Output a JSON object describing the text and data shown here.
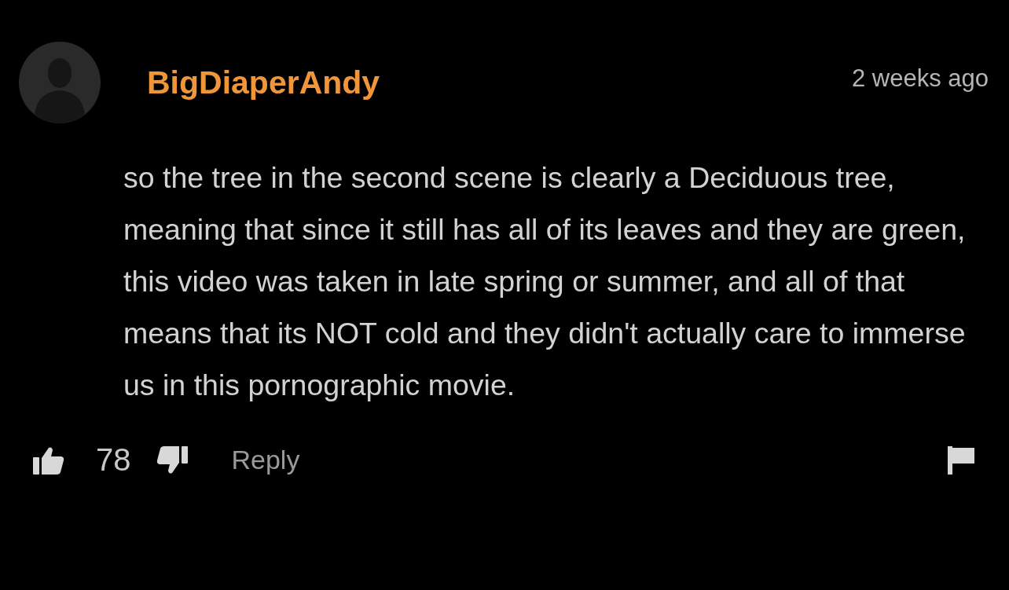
{
  "comment": {
    "username": "BigDiaperAndy",
    "time": "2 weeks ago",
    "text": "so the tree in the second scene is clearly a Deciduous tree, meaning that since it still has all of its leaves and they are green, this video was taken in late spring or summer, and all of that means that its NOT cold and they didn't actually care to immerse us in this pornographic movie.",
    "likes": "78",
    "reply": "Reply"
  }
}
